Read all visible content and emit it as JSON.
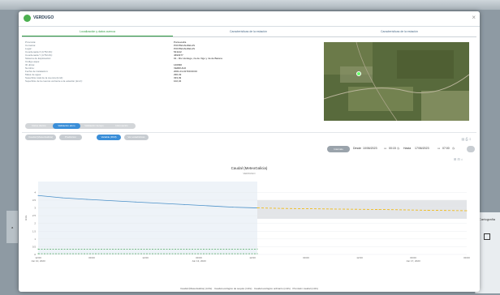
{
  "modal": {
    "title": "VERDUGO",
    "close_glyph": "×",
    "tabs": [
      "Localización y datos cuenca",
      "Características de la estación",
      "Características de la estación"
    ]
  },
  "info": [
    {
      "k": "Provincia:",
      "v": "Pontevedra"
    },
    {
      "k": "Comarca:",
      "v": "PONTECALDELAS"
    },
    {
      "k": "Lugar:",
      "v": "PONTECALDELAS"
    },
    {
      "k": "Coordenada X (UTM 29):",
      "v": "541142"
    },
    {
      "k": "Coordenada Y (UTM 29):",
      "v": "4693377"
    },
    {
      "k": "Sistema de Explotación:",
      "v": "01 - Río Verdugo, ría de Vigo y ría de Baiona"
    },
    {
      "k": "Código aqua:",
      "v": ""
    },
    {
      "k": "ID ubica:",
      "v": "140090"
    },
    {
      "k": "Nombre:",
      "v": "VERDUGO"
    },
    {
      "k": "Fecha de instalación:",
      "v": "2001-01-01T00:00:00"
    },
    {
      "k": "Masa de agua:",
      "v": "296-33"
    },
    {
      "k": "Superficie total de la cuenca (km2):",
      "v": "333,49"
    },
    {
      "k": "Superficie de la cuenca vertiente a la estación (km2):",
      "v": "102,34"
    }
  ],
  "pills": [
    "Datos diarios",
    "Validación aforo",
    "Validación tiempo",
    "Información"
  ],
  "subpills": [
    "Caudal (MeteoGalicia)",
    "Prediccion",
    "Variable (DMI)",
    "Ver estadísticas"
  ],
  "date_filter": {
    "button": "Intervalo",
    "desde_label": "Desde",
    "desde_date": "10/06/2023",
    "desde_time": "00:15",
    "hasta_label": "Hasta",
    "hasta_date": "17/06/2023",
    "hasta_time": "07:00"
  },
  "icons": {
    "calendar": "calendar-icon",
    "clock": "clock-icon",
    "close": "close-icon"
  },
  "colors": {
    "accent_green": "#2f9a42",
    "blue": "#3a8ed8",
    "series_caudal": "#4a90c8",
    "series_prediccion": "#f2b705",
    "series_ecologico": "#2f9a42"
  },
  "chart_data": {
    "type": "line",
    "title": "Caudal (MeteoGalicia)",
    "subtitle": "VERDUGO",
    "xlabel": "",
    "ylabel": "m3/s",
    "ylim": [
      0,
      4.7
    ],
    "grid": true,
    "x_ticks": [
      "12:00\nJun 10, 2023",
      "00:00",
      "12:00",
      "00:00\nJun 13, 2023",
      "12:00",
      "00:00",
      "12:00",
      "00:00\nJun 17, 2023",
      "00:00"
    ],
    "y_ticks": [
      "0",
      "0.5",
      "1",
      "1.5",
      "2",
      "2.5",
      "3",
      "3.5",
      "4"
    ],
    "series": [
      {
        "name": "Caudal (MeteoGalicia) (m3/s)",
        "style": "solid",
        "x": [
          0,
          0.5,
          1,
          2,
          3,
          4,
          4.5
        ],
        "y": [
          3.8,
          3.65,
          3.55,
          3.38,
          3.22,
          3.05,
          3.0
        ]
      },
      {
        "name": "Caudal ecológico de sequía (m3/s)",
        "style": "dashed",
        "x": [
          0,
          4.5
        ],
        "y": [
          0.05,
          0.05
        ]
      },
      {
        "name": "Caudal ecológico ordinario (m3/s)",
        "style": "dashed",
        "x": [
          0,
          4.5
        ],
        "y": [
          0.35,
          0.35
        ]
      },
      {
        "name": "Previsión caudal (m3/s)",
        "style": "dashed",
        "x": [
          4.5,
          5,
          6,
          7,
          8,
          8.8
        ],
        "y": [
          3.0,
          2.97,
          2.93,
          2.9,
          2.85,
          2.82
        ]
      }
    ]
  },
  "background": {
    "right_label": "Cartografía"
  }
}
